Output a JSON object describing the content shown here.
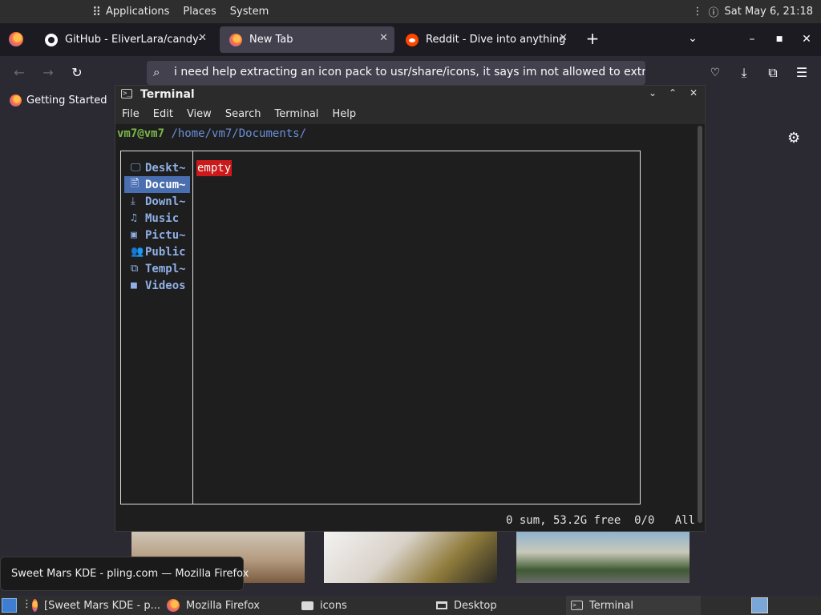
{
  "top_panel": {
    "menus": [
      "Applications",
      "Places",
      "System"
    ],
    "clock": "Sat May 6, 21:18"
  },
  "firefox": {
    "tabs": [
      {
        "title": "GitHub - EliverLara/candy-icons",
        "active": false
      },
      {
        "title": "New Tab",
        "active": true
      },
      {
        "title": "Reddit - Dive into anything",
        "active": false
      }
    ],
    "url_text": "i need help extracting an icon pack to usr/share/icons, it says im not allowed to extract to",
    "bookmark": "Getting Started"
  },
  "terminal": {
    "title": "Terminal",
    "menu": [
      "File",
      "Edit",
      "View",
      "Search",
      "Terminal",
      "Help"
    ],
    "prompt_user": "vm7@vm7",
    "prompt_path": "/home/vm7/Documents/",
    "bookmarks": [
      {
        "glyph": "🖵",
        "label": "Deskt~",
        "selected": false
      },
      {
        "glyph": "🖹",
        "label": "Docum~",
        "selected": true
      },
      {
        "glyph": "⤓",
        "label": "Downl~",
        "selected": false
      },
      {
        "glyph": "♫",
        "label": "Music",
        "selected": false
      },
      {
        "glyph": "▣",
        "label": "Pictu~",
        "selected": false
      },
      {
        "glyph": "👥",
        "label": "Public",
        "selected": false
      },
      {
        "glyph": "⧉",
        "label": "Templ~",
        "selected": false
      },
      {
        "glyph": "■",
        "label": "Videos",
        "selected": false
      }
    ],
    "empty_label": "empty",
    "status": "0 sum, 53.2G free  0/0   All"
  },
  "tooltip": "Sweet Mars KDE - pling.com — Mozilla Firefox",
  "taskbar": {
    "items": [
      {
        "label": "[Sweet Mars KDE - p...",
        "icon": "firefox-icon",
        "active": false
      },
      {
        "label": "Mozilla Firefox",
        "icon": "firefox-icon",
        "active": false
      },
      {
        "label": "icons",
        "icon": "folder-icon",
        "active": false
      },
      {
        "label": "Desktop",
        "icon": "desktop-icon",
        "active": false
      },
      {
        "label": "Terminal",
        "icon": "terminal-icon",
        "active": true
      }
    ]
  }
}
